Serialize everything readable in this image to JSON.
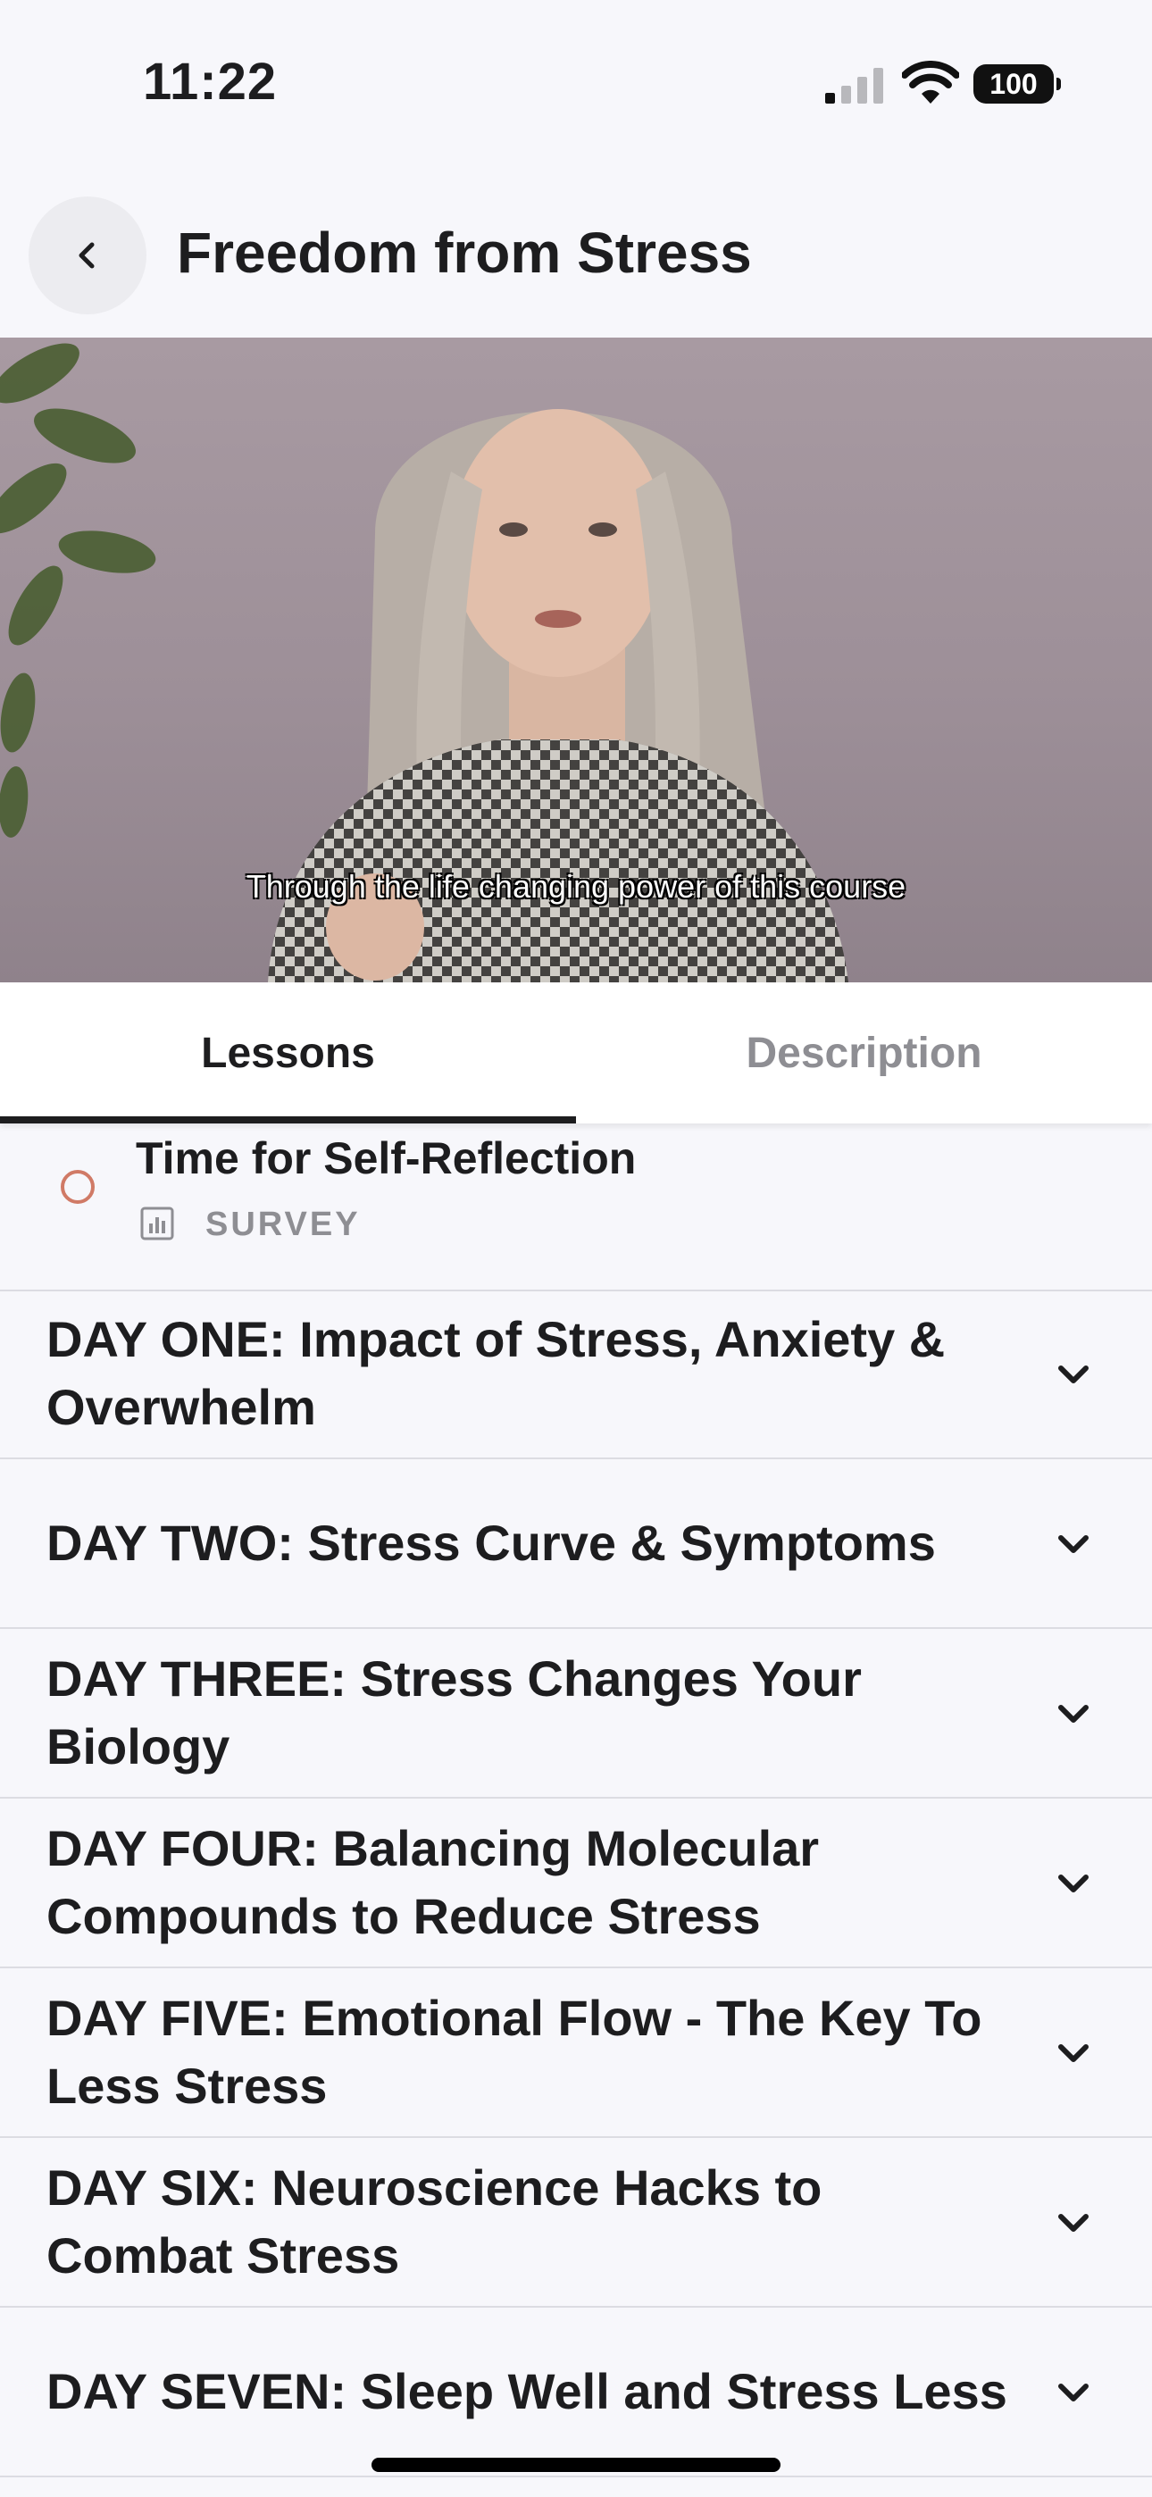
{
  "status_bar": {
    "time": "11:22",
    "battery": "100"
  },
  "header": {
    "title": "Freedom from Stress"
  },
  "video": {
    "subtitle": "Through the life changing power of this course"
  },
  "tabs": [
    {
      "label": "Lessons",
      "selected": true
    },
    {
      "label": "Description",
      "selected": false
    }
  ],
  "lesson": {
    "title": "Time for Self-Reflection",
    "type": "SURVEY"
  },
  "days": [
    {
      "title": "DAY ONE: Impact of Stress, Anxiety & Overwhelm"
    },
    {
      "title": "DAY TWO: Stress Curve & Symptoms"
    },
    {
      "title": "DAY THREE: Stress Changes Your Biology"
    },
    {
      "title": "DAY FOUR: Balancing Molecular Compounds to Reduce Stress"
    },
    {
      "title": "DAY FIVE: Emotional Flow - The Key To Less Stress"
    },
    {
      "title": "DAY SIX: Neuroscience Hacks to Combat Stress"
    },
    {
      "title": "DAY SEVEN: Sleep Well and Stress Less"
    }
  ],
  "colors": {
    "accent_radio": "#d07a66",
    "background": "#f7f7fb",
    "text": "#1d1d1f",
    "muted": "#8e8e93"
  }
}
